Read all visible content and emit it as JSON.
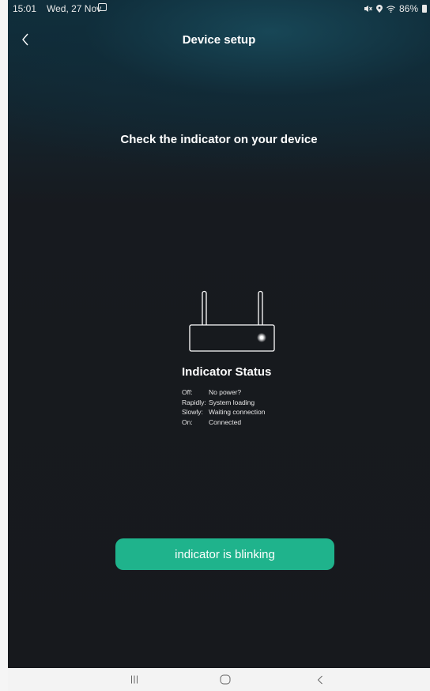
{
  "status_bar": {
    "time": "15:01",
    "date": "Wed, 27 Nov",
    "battery": "86%"
  },
  "header": {
    "title": "Device setup"
  },
  "main": {
    "heading": "Check the indicator on your device",
    "indicator_status_title": "Indicator Status",
    "states": [
      {
        "key": "Off:",
        "value": "No power?"
      },
      {
        "key": "Rapidly:",
        "value": "System loading"
      },
      {
        "key": "Slowly:",
        "value": "Waiting connection"
      },
      {
        "key": "On:",
        "value": "Connected"
      }
    ],
    "action_button": "indicator is blinking"
  },
  "colors": {
    "accent": "#1fb38c",
    "background": "#17191d"
  },
  "icons": {
    "back": "chevron-left-icon",
    "router": "router-icon",
    "nav_recents": "recents-icon",
    "nav_home": "home-icon",
    "nav_back": "back-nav-icon"
  }
}
